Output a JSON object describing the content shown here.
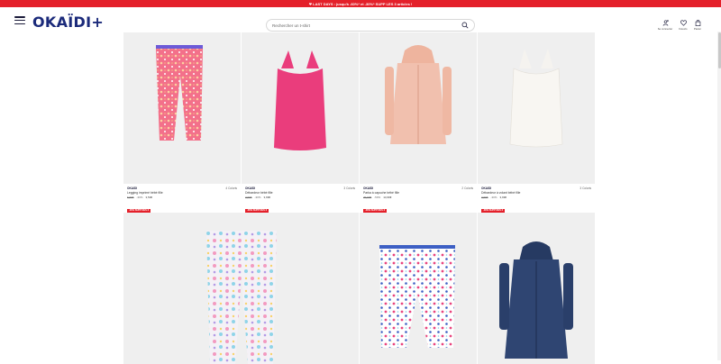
{
  "promo": {
    "text": "❤ LAST DAYS : jusqu'à -60%* et -30%* SUPP LES 3 articles !"
  },
  "header": {
    "logo": "OKAÏDI+",
    "search_placeholder": "Rechercher un t-shirt",
    "account_label": "Se connecter",
    "wishlist_label": "Favoris",
    "cart_label": "Panier"
  },
  "products": [
    {
      "brand": "OKAIDI",
      "name": "Legging imprimé bébé fille",
      "colors": "4 Coloris",
      "old_price": "6,99€",
      "discount": "-30%",
      "price": "3,50€",
      "badge": "-30% SUPP DÈS 3",
      "color": "#f3708a"
    },
    {
      "brand": "OKAIDI",
      "name": "Débardeur bébé fille",
      "colors": "3 Coloris",
      "old_price": "7,99€",
      "discount": "-30%",
      "price": "3,99€",
      "badge": "-30% SUPP DÈS 3",
      "color": "#ea3d7c"
    },
    {
      "brand": "OKAIDI",
      "name": "Parka à capuche bébé fille",
      "colors": "2 Coloris",
      "old_price": "29,99€",
      "discount": "-50%",
      "price": "14,99€",
      "badge": "-30% SUPP DÈS 3",
      "color": "#f1c0ae"
    },
    {
      "brand": "OKAIDI",
      "name": "Débardeur à volant bébé fille",
      "colors": "3 Coloris",
      "old_price": "7,99€",
      "discount": "-30%",
      "price": "3,99€",
      "badge": "-30% SUPP DÈS 3",
      "color": "#f5f3ef"
    }
  ]
}
